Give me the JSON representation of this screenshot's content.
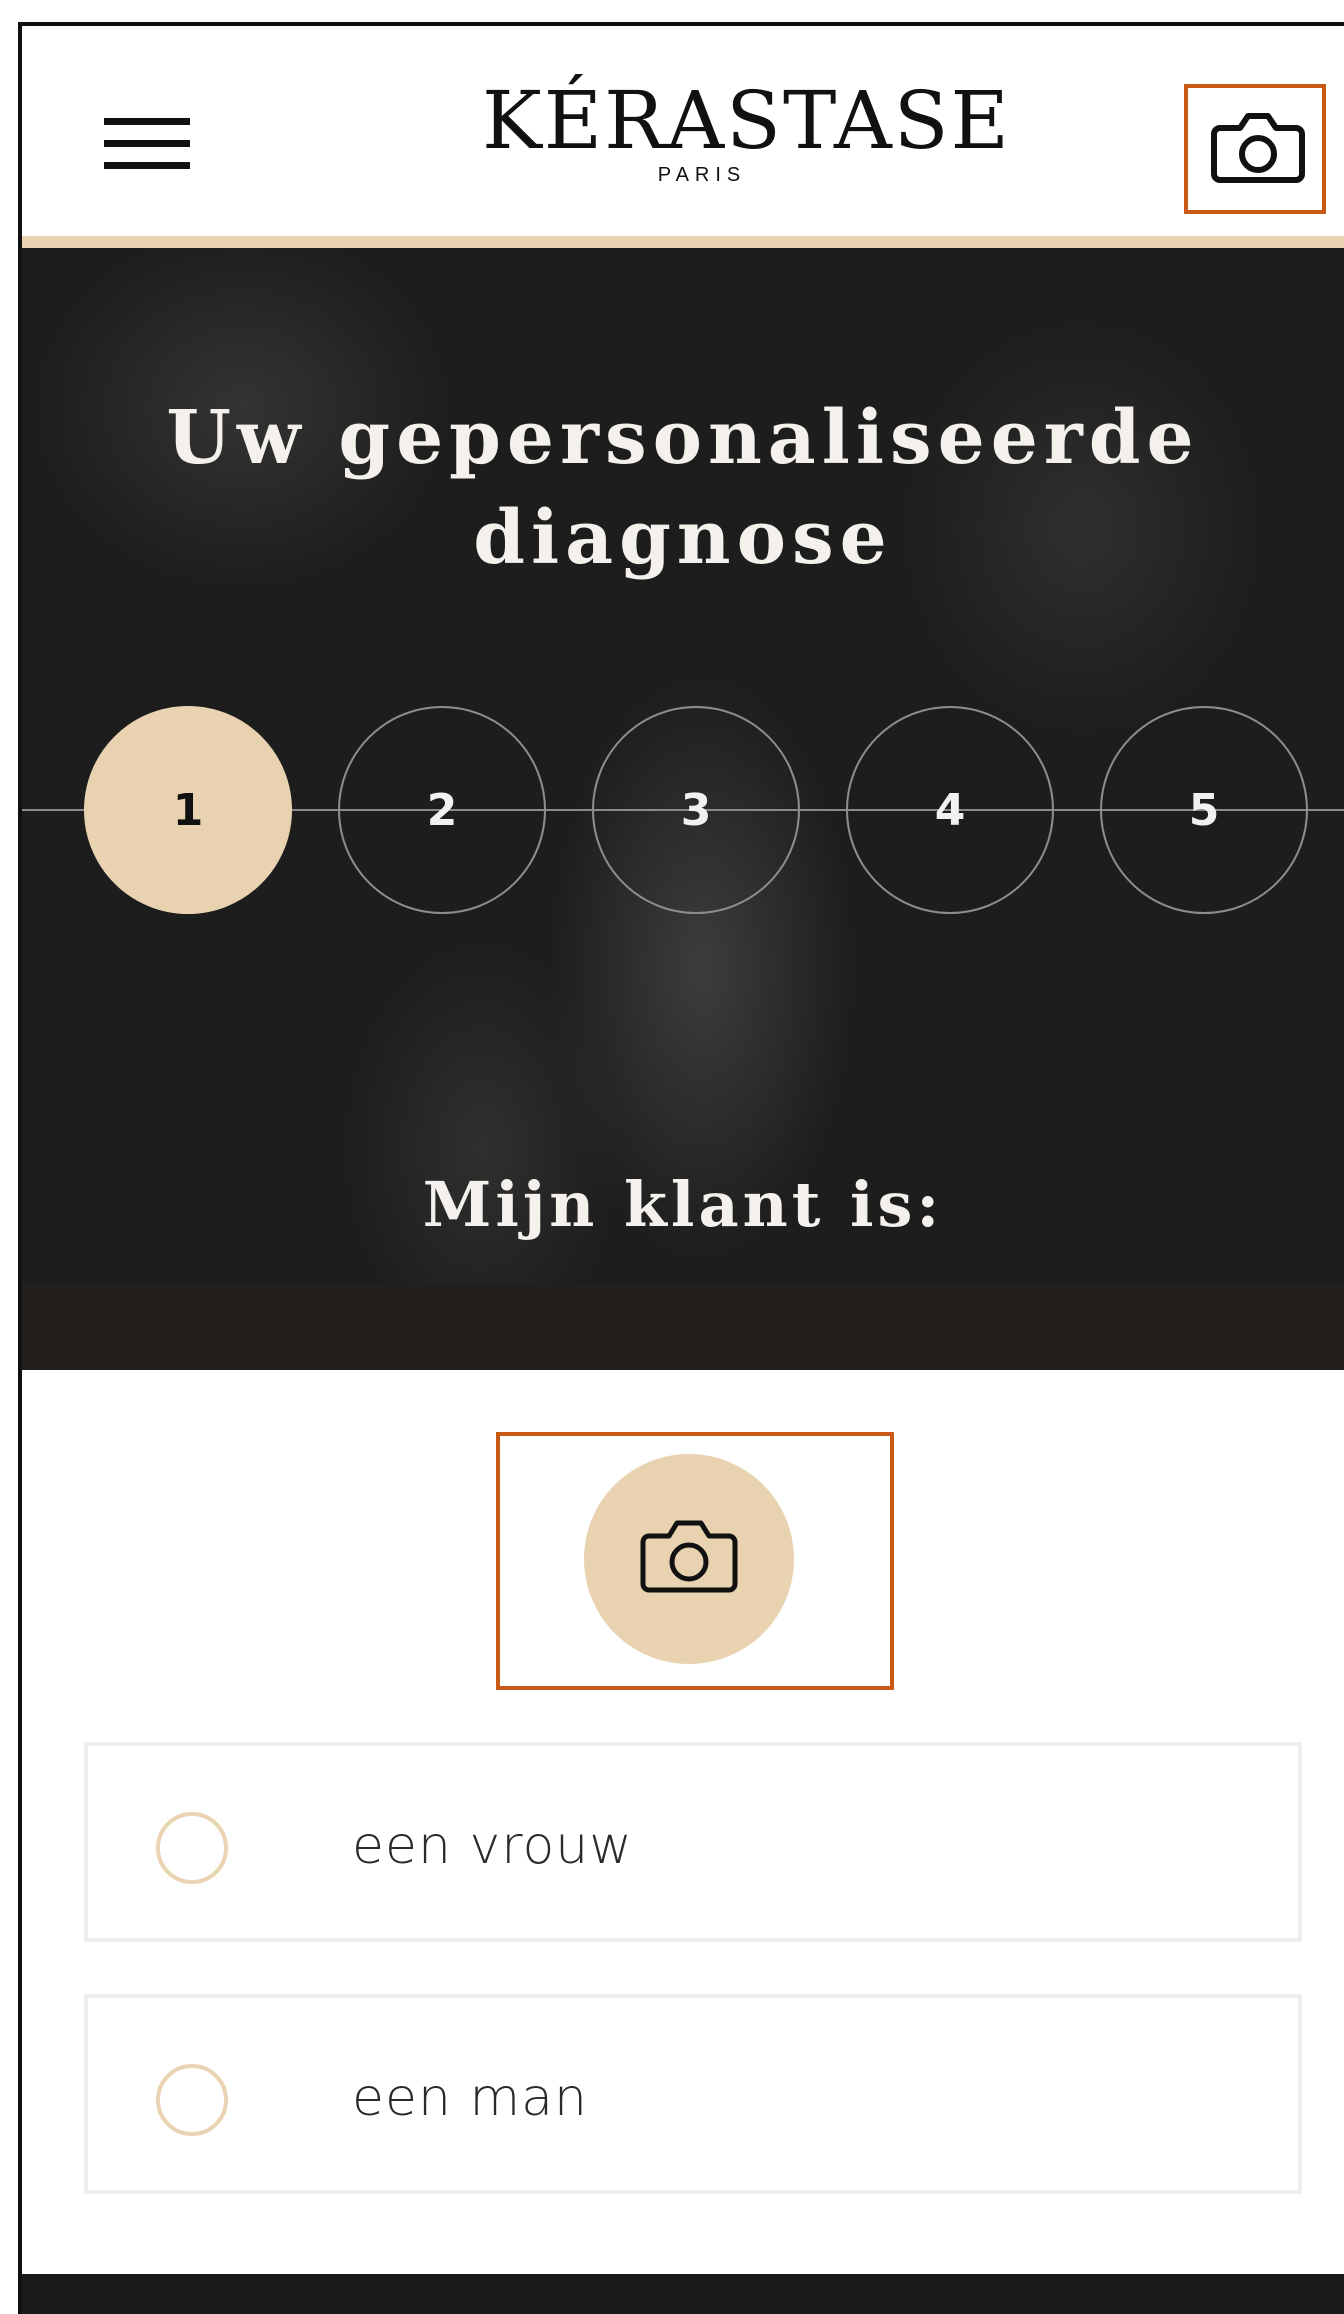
{
  "header": {
    "logo_main": "KÉRASTASE",
    "logo_sub": "PARIS",
    "menu_icon": "hamburger-menu-icon",
    "camera_icon": "camera-icon"
  },
  "hero": {
    "title_line1": "Uw gepersonaliseerde",
    "title_line2": "diagnose",
    "steps": [
      "1",
      "2",
      "3",
      "4",
      "5"
    ],
    "active_step": 1,
    "question": "Mijn klant is:"
  },
  "photo": {
    "icon": "camera-icon"
  },
  "options": [
    {
      "label": "een vrouw",
      "selected": false
    },
    {
      "label": "een man",
      "selected": false
    }
  ],
  "colors": {
    "accent_gold": "#e8d2b0",
    "highlight_box": "#c85a16",
    "hero_bg": "#1d1d1d"
  }
}
